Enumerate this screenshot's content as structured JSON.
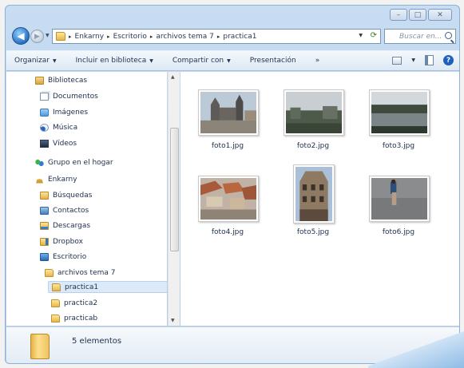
{
  "window": {
    "controls": {
      "minimize": "–",
      "maximize": "□",
      "close": "✕"
    }
  },
  "address": {
    "breadcrumbs": [
      "Enkarny",
      "Escritorio",
      "archivos tema 7",
      "practica1"
    ],
    "search_placeholder": "Buscar en...",
    "refresh_icon": "refresh-icon"
  },
  "toolbar": {
    "organize": "Organizar",
    "include": "Incluir en biblioteca",
    "share": "Compartir con",
    "presentation": "Presentación",
    "help": "?"
  },
  "nav": {
    "items": [
      {
        "label": "Bibliotecas",
        "icon": "library-icon"
      },
      {
        "label": "Documentos",
        "icon": "documents-icon"
      },
      {
        "label": "Imágenes",
        "icon": "pictures-icon"
      },
      {
        "label": "Música",
        "icon": "music-icon"
      },
      {
        "label": "Vídeos",
        "icon": "videos-icon"
      },
      {
        "label": "Grupo en el hogar",
        "icon": "homegroup-icon"
      },
      {
        "label": "Enkarny",
        "icon": "user-folder-icon"
      },
      {
        "label": "Búsquedas",
        "icon": "searches-folder-icon"
      },
      {
        "label": "Contactos",
        "icon": "contacts-folder-icon"
      },
      {
        "label": "Descargas",
        "icon": "downloads-folder-icon"
      },
      {
        "label": "Dropbox",
        "icon": "dropbox-folder-icon"
      },
      {
        "label": "Escritorio",
        "icon": "desktop-folder-icon"
      },
      {
        "label": "archivos tema 7",
        "icon": "folder-icon"
      },
      {
        "label": "practica1",
        "icon": "folder-icon"
      },
      {
        "label": "practica2",
        "icon": "folder-icon"
      },
      {
        "label": "practicab",
        "icon": "folder-icon"
      }
    ]
  },
  "files": [
    {
      "name": "foto1.jpg"
    },
    {
      "name": "foto2.jpg"
    },
    {
      "name": "foto3.jpg"
    },
    {
      "name": "foto4.jpg"
    },
    {
      "name": "foto5.jpg"
    },
    {
      "name": "foto6.jpg"
    }
  ],
  "details": {
    "count": "5 elementos"
  },
  "colors": {
    "selected": "#dbe9f8",
    "accent": "#2b6fc2"
  }
}
